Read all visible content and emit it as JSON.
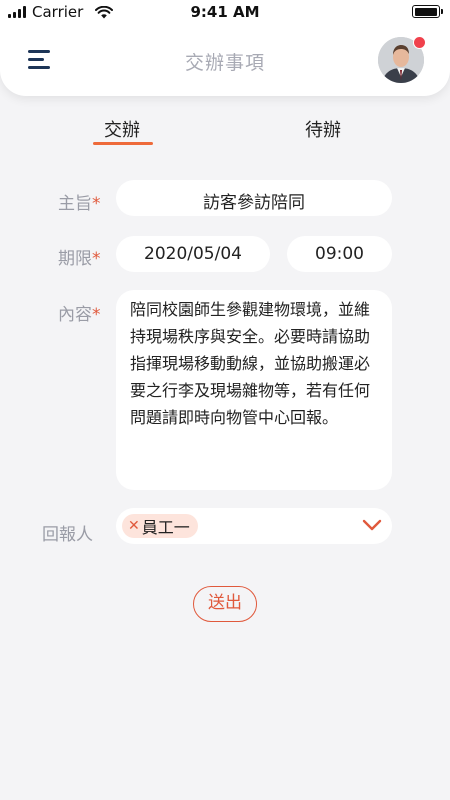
{
  "status": {
    "carrier": "Carrier",
    "time": "9:41 AM",
    "battery_level": 1.0
  },
  "header": {
    "title": "交辦事項",
    "menu_icon": "menu-icon",
    "has_notification": true
  },
  "tabs": [
    {
      "label": "交辦",
      "active": true
    },
    {
      "label": "待辦",
      "active": false
    }
  ],
  "form": {
    "subject_label": "主旨",
    "subject_value": "訪客參訪陪同",
    "deadline_label": "期限",
    "deadline_date": "2020/05/04",
    "deadline_time": "09:00",
    "content_label": "內容",
    "content_value": "陪同校園師生參觀建物環境，並維持現場秩序與安全。必要時請協助指揮現場移動動線，並協助搬運必要之行李及現場雜物等，若有任何問題請即時向物管中心回報。",
    "reporter_label": "回報人",
    "reporter_chip": "員工一",
    "required_mark": "*"
  },
  "actions": {
    "submit_label": "送出"
  },
  "colors": {
    "accent": "#ee6a3a",
    "title": "#a8aab4",
    "label": "#9a9ca6",
    "badge": "#f0414c"
  }
}
